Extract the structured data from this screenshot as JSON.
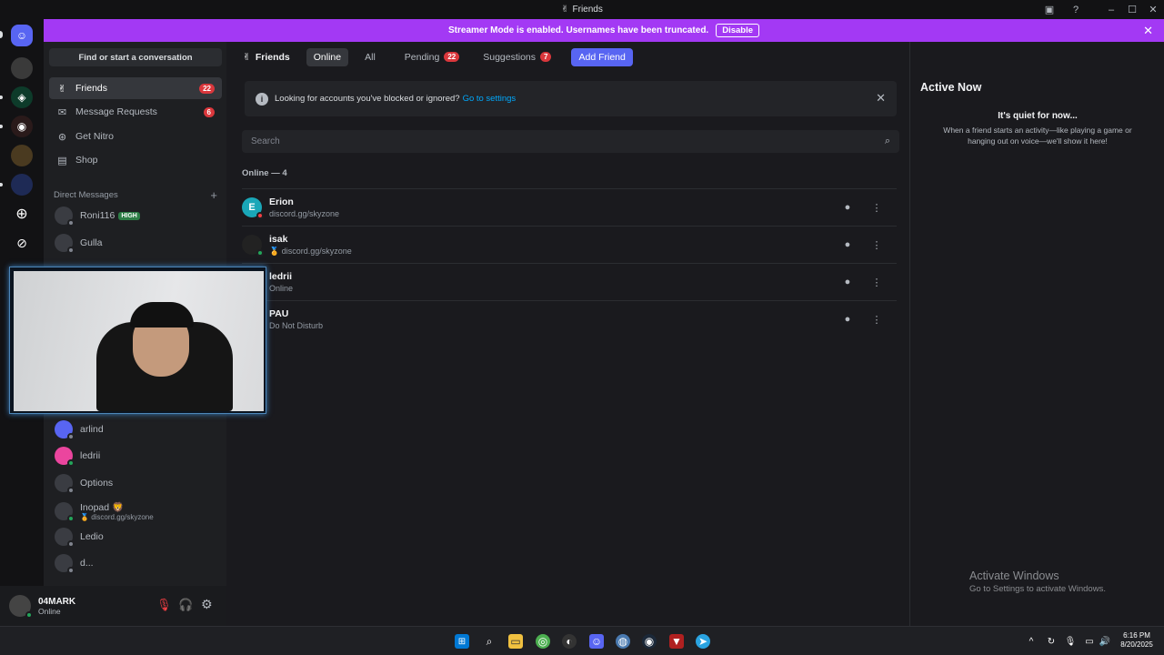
{
  "window": {
    "title": "Friends"
  },
  "banner": {
    "text": "Streamer Mode is enabled. Usernames have been truncated.",
    "disable_label": "Disable"
  },
  "sidebar": {
    "search_label": "Find or start a conversation",
    "nav": [
      {
        "label": "Friends",
        "badge": "22",
        "icon": "friends-icon"
      },
      {
        "label": "Message Requests",
        "badge": "6",
        "icon": "mail-icon"
      },
      {
        "label": "Get Nitro",
        "icon": "nitro-icon"
      },
      {
        "label": "Shop",
        "icon": "shop-icon"
      }
    ],
    "dm_header": "Direct Messages",
    "dms_top": [
      {
        "name": "Roni116",
        "tag": "HIGH"
      },
      {
        "name": "Gulla"
      }
    ],
    "dms_bottom": [
      {
        "name": "arlind"
      },
      {
        "name": "ledrii"
      },
      {
        "name": "Options"
      },
      {
        "name": "Inopad",
        "emoji": "🦁",
        "sub": "discord.gg/skyzone",
        "sub_emoji": "🏅"
      },
      {
        "name": "Ledio"
      },
      {
        "name": "d..."
      }
    ]
  },
  "user": {
    "name": "04MARK",
    "status": "Online"
  },
  "topbar": {
    "friends_label": "Friends",
    "tabs": [
      {
        "label": "Online"
      },
      {
        "label": "All"
      },
      {
        "label": "Pending",
        "badge": "22"
      },
      {
        "label": "Suggestions",
        "badge": "7"
      }
    ],
    "add_friend_label": "Add Friend"
  },
  "notice": {
    "text": "Looking for accounts you've blocked or ignored?",
    "link": "Go to settings"
  },
  "search": {
    "placeholder": "Search"
  },
  "online_header": "Online — 4",
  "friends": [
    {
      "name": "Erion",
      "status": "discord.gg/skyzone"
    },
    {
      "name": "isak",
      "status": "discord.gg/skyzone",
      "status_emoji": "🏅"
    },
    {
      "name": "ledrii",
      "status": "Online"
    },
    {
      "name": "PAU",
      "status": "Do Not Disturb"
    }
  ],
  "active_now": {
    "title": "Active Now",
    "heading": "It's quiet for now...",
    "body": "When a friend starts an activity—like playing a game or hanging out on voice—we'll show it here!"
  },
  "watermark": {
    "title": "Activate Windows",
    "sub": "Go to Settings to activate Windows."
  },
  "clock": {
    "time": "6:16 PM",
    "date": "8/20/2025"
  },
  "colors": {
    "accent": "#5865f2",
    "banner": "#a339f4",
    "online": "#23a55a",
    "dnd": "#f23f43",
    "badge": "#da373c"
  }
}
